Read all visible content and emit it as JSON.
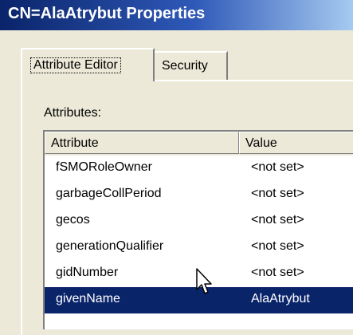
{
  "window": {
    "title": "CN=AlaAtrybut Properties"
  },
  "tabs": [
    {
      "label": "Attribute Editor",
      "selected": true
    },
    {
      "label": "Security",
      "selected": false
    }
  ],
  "attributes_label": "Attributes:",
  "list": {
    "columns": [
      "Attribute",
      "Value"
    ],
    "rows": [
      {
        "attribute": "fSMORoleOwner",
        "value": "<not set>",
        "selected": false
      },
      {
        "attribute": "garbageCollPeriod",
        "value": "<not set>",
        "selected": false
      },
      {
        "attribute": "gecos",
        "value": "<not set>",
        "selected": false
      },
      {
        "attribute": "generationQualifier",
        "value": "<not set>",
        "selected": false
      },
      {
        "attribute": "gidNumber",
        "value": "<not set>",
        "selected": false
      },
      {
        "attribute": "givenName",
        "value": "AlaAtrybut",
        "selected": true
      }
    ]
  },
  "colors": {
    "titlebar_start": "#0A246A",
    "titlebar_end": "#A6CAF0",
    "selection": "#0A246A",
    "dialog_face": "#ECE9D8"
  },
  "icons": {
    "cursor": "arrow-cursor-icon"
  }
}
